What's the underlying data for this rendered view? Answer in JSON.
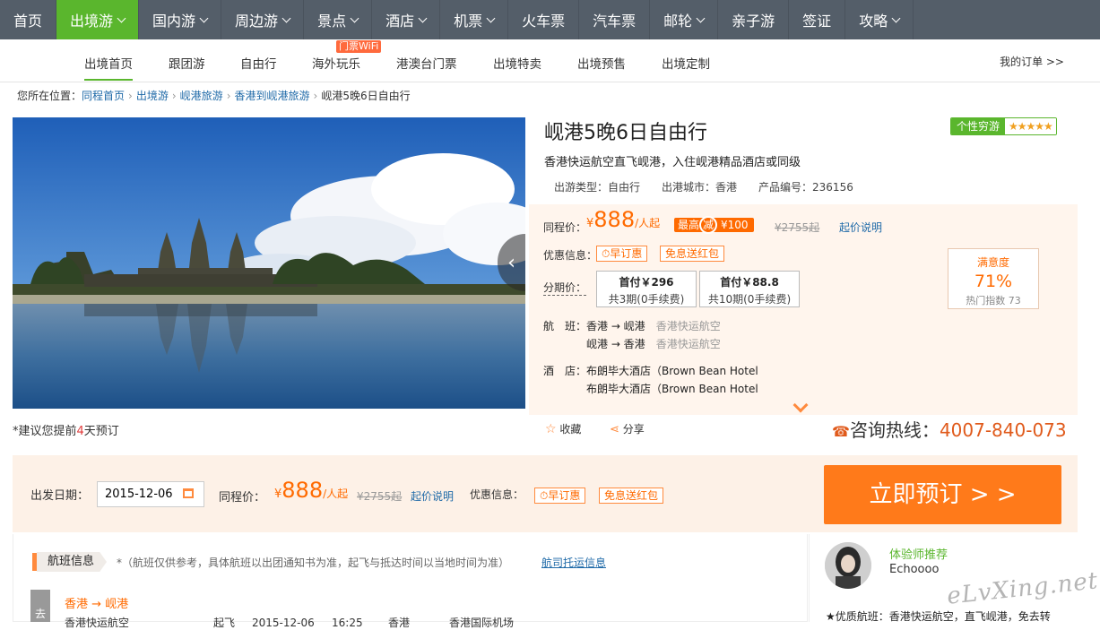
{
  "topnav": {
    "items": [
      {
        "label": "首页",
        "dropdown": false
      },
      {
        "label": "出境游",
        "dropdown": true,
        "active": true
      },
      {
        "label": "国内游",
        "dropdown": true
      },
      {
        "label": "周边游",
        "dropdown": true
      },
      {
        "label": "景点",
        "dropdown": true
      },
      {
        "label": "酒店",
        "dropdown": true
      },
      {
        "label": "机票",
        "dropdown": true
      },
      {
        "label": "火车票",
        "dropdown": false
      },
      {
        "label": "汽车票",
        "dropdown": false
      },
      {
        "label": "邮轮",
        "dropdown": true
      },
      {
        "label": "亲子游",
        "dropdown": false
      },
      {
        "label": "签证",
        "dropdown": false
      },
      {
        "label": "攻略",
        "dropdown": true
      }
    ]
  },
  "subnav": {
    "items": [
      "出境首页",
      "跟团游",
      "自由行",
      "海外玩乐",
      "港澳台门票",
      "出境特卖",
      "出境预售",
      "出境定制"
    ],
    "badge": "门票WiFi",
    "my_orders": "我的订单 >>"
  },
  "breadcrumb": {
    "prefix": "您所在位置：",
    "links": [
      "同程首页",
      "出境游",
      "岘港旅游",
      "香港到岘港旅游"
    ],
    "current": "岘港5晚6日自由行"
  },
  "product": {
    "title": "岘港5晚6日自由行",
    "style_badge": "个性穷游",
    "stars": "★★★★★",
    "subtitle": "香港快运航空直飞岘港，入住岘港精品酒店或同级",
    "meta": [
      "出游类型：自由行",
      "出港城市：香港",
      "产品编号：236156"
    ],
    "book_note_pre": "*建议您提前",
    "book_note_days": "4",
    "book_note_post": "天预订"
  },
  "pricing": {
    "label": "同程价：",
    "currency": "¥",
    "price": "888",
    "unit": "/人起",
    "max_badge_a": "最高",
    "max_badge_b": "减",
    "max_badge_c": "¥100",
    "original": "¥2755起",
    "note_link": "起价说明",
    "promo_label": "优惠信息：",
    "promo_tags": [
      "早订惠",
      "免息送红包"
    ],
    "installment_label": "分期价：",
    "installments": [
      {
        "title": "首付￥296",
        "detail": "共3期(0手续费)"
      },
      {
        "title": "首付￥88.8",
        "detail": "共10期(0手续费)"
      }
    ],
    "satisfaction": {
      "label": "满意度",
      "value": "71%",
      "popularity": "热门指数 73"
    }
  },
  "details": {
    "flight_label": "航　班：",
    "flights": [
      {
        "route": "香港 → 岘港",
        "carrier": "香港快运航空"
      },
      {
        "route": "岘港 → 香港",
        "carrier": "香港快运航空"
      }
    ],
    "hotel_label": "酒　店：",
    "hotels": [
      "布朗毕大酒店（Brown Bean Hotel",
      "布朗毕大酒店（Brown Bean Hotel"
    ]
  },
  "actions": {
    "favorite": "收藏",
    "share": "分享",
    "hotline_label": "咨询热线：",
    "hotline_number": "4007-840-073"
  },
  "booking_bar": {
    "date_label": "出发日期：",
    "date_value": "2015-12-06",
    "book_button": "立即预订 > >"
  },
  "flight_info": {
    "heading": "航班信息",
    "note": "*（航班仅供参考，具体航班以出团通知书为准，起飞与抵达时间以当地时间为准）",
    "carrier_link": "航司托运信息",
    "tab_label": "去",
    "route": "香港 → 岘港",
    "row": [
      "香港快运航空",
      "起飞",
      "2015-12-06",
      "16:25",
      "香港",
      "香港国际机场"
    ]
  },
  "recommend": {
    "title": "体验师推荐",
    "name": "Echoooo",
    "text": "★优质航班：香港快运航空，直飞岘港，免去转"
  },
  "watermark": "eLvXing.net",
  "colors": {
    "green": "#5ab62d",
    "orange": "#ff6a00",
    "nav": "#545e69",
    "link": "#1f6aa8"
  }
}
